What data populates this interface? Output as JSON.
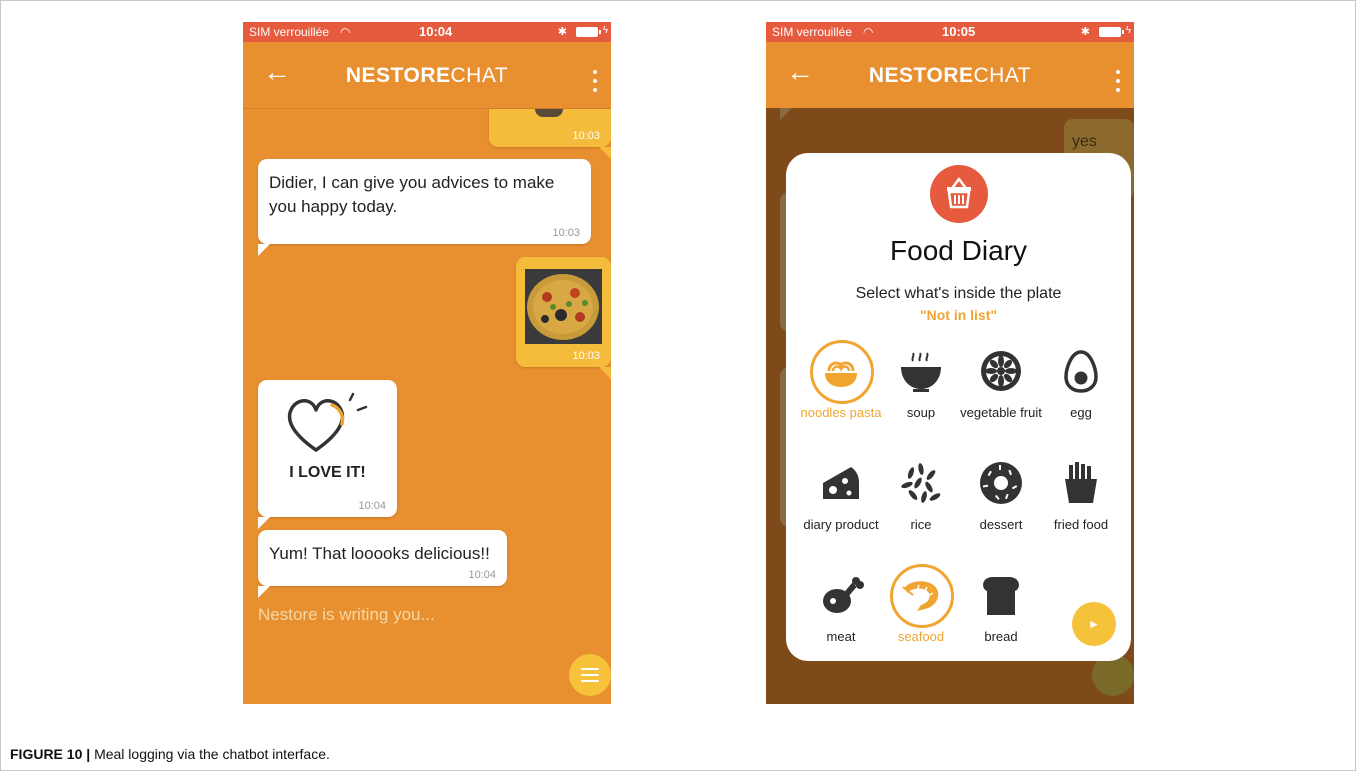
{
  "figure": {
    "label": "FIGURE 10 |",
    "caption": "Meal logging via the chatbot interface."
  },
  "left_phone": {
    "status": {
      "carrier": "SIM verrouillée",
      "time": "10:04"
    },
    "header": {
      "back": "←",
      "brand_bold": "NESTORE",
      "brand_light": "CHAT"
    },
    "messages": [
      {
        "from": "user",
        "type": "image",
        "time": "10:03"
      },
      {
        "from": "bot",
        "type": "text",
        "text": "Didier, I can give you advices to make you happy today.",
        "time": "10:03"
      },
      {
        "from": "user",
        "type": "image",
        "alt": "paella photo",
        "time": "10:03"
      },
      {
        "from": "bot",
        "type": "sticker",
        "sticker_text": "I LOVE IT!",
        "time": "10:04"
      },
      {
        "from": "bot",
        "type": "text",
        "text": "Yum! That looooks delicious!!",
        "time": "10:04"
      }
    ],
    "typing_indicator": "Nestore is writing you..."
  },
  "right_phone": {
    "status": {
      "carrier": "SIM verrouillée",
      "time": "10:05"
    },
    "header": {
      "back": "←",
      "brand_bold": "NESTORE",
      "brand_light": "CHAT"
    },
    "background_message": "yes",
    "modal": {
      "icon": "basket-icon",
      "title": "Food Diary",
      "subtitle": "Select what's inside the plate",
      "selection_hint": "\"Not in list\"",
      "items": [
        {
          "label": "noodles pasta",
          "icon": "noodles-icon",
          "selected": true
        },
        {
          "label": "soup",
          "icon": "soup-icon",
          "selected": false
        },
        {
          "label": "vegetable fruit",
          "icon": "vegetable-icon",
          "selected": false
        },
        {
          "label": "egg",
          "icon": "egg-icon",
          "selected": false
        },
        {
          "label": "diary product",
          "icon": "cheese-icon",
          "selected": false
        },
        {
          "label": "rice",
          "icon": "rice-icon",
          "selected": false
        },
        {
          "label": "dessert",
          "icon": "donut-icon",
          "selected": false
        },
        {
          "label": "fried food",
          "icon": "fries-icon",
          "selected": false
        },
        {
          "label": "meat",
          "icon": "drumstick-icon",
          "selected": false
        },
        {
          "label": "seafood",
          "icon": "shrimp-icon",
          "selected": true
        },
        {
          "label": "bread",
          "icon": "bread-icon",
          "selected": false
        }
      ],
      "send_icon": "send-icon"
    }
  },
  "colors": {
    "chat_background": "#E88F30",
    "status_bar": "#E65A3E",
    "user_bubble": "#F5BB3A",
    "selected_accent": "#F0A531",
    "dimmed_background": "#7E4A1A"
  }
}
